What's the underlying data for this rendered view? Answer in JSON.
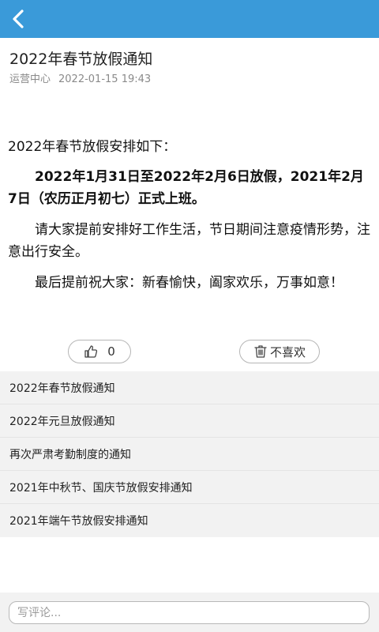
{
  "header": {
    "back_icon": "chevron-left-icon",
    "bar_color": "#3a9ad9"
  },
  "article": {
    "title": "2022年春节放假通知",
    "source": "运营中心",
    "date": "2022-01-15 19:43",
    "paragraphs": [
      "2022年春节放假安排如下：",
      "2022年1月31日至2022年2月6日放假，2021年2月7日（农历正月初七）正式上班。",
      "请大家提前安排好工作生活，节日期间注意疫情形势，注意出行安全。",
      "最后提前祝大家：新春愉快，阖家欢乐，万事如意！"
    ]
  },
  "actions": {
    "like_icon": "thumbs-up-icon",
    "like_count": "0",
    "dislike_icon": "trash-icon",
    "dislike_label": "不喜欢"
  },
  "related": [
    "2022年春节放假通知",
    "2022年元旦放假通知",
    "再次严肃考勤制度的通知",
    "2021年中秋节、国庆节放假安排通知",
    "2021年端午节放假安排通知"
  ],
  "comment": {
    "placeholder": "写评论..."
  }
}
